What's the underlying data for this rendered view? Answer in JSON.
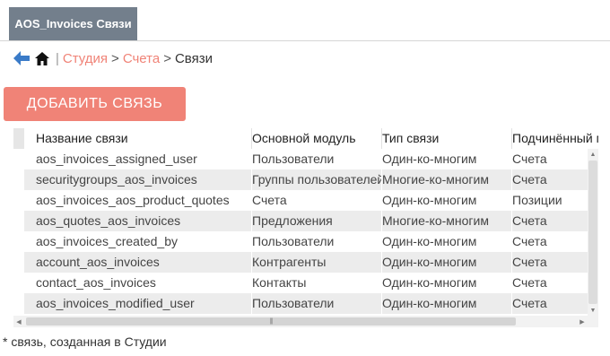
{
  "tab": {
    "label": "AOS_Invoices Связи"
  },
  "breadcrumb": {
    "back_icon": "back-arrow-icon",
    "home_icon": "home-icon",
    "separator": "|",
    "items": [
      "Студия",
      "Счета",
      "Связи"
    ],
    "arrow": ">"
  },
  "add_button": {
    "label": "ДОБАВИТЬ СВЯЗЬ"
  },
  "table": {
    "columns": [
      "Название связи",
      "Основной модуль",
      "Тип связи",
      "Подчинённый модуль"
    ],
    "rows": [
      [
        "aos_invoices_assigned_user",
        "Пользователи",
        "Один-ко-многим",
        "Счета"
      ],
      [
        "securitygroups_aos_invoices",
        "Группы пользователей",
        "Многие-ко-многим",
        "Счета"
      ],
      [
        "aos_invoices_aos_product_quotes",
        "Счета",
        "Один-ко-многим",
        "Позиции"
      ],
      [
        "aos_quotes_aos_invoices",
        "Предложения",
        "Многие-ко-многим",
        "Счета"
      ],
      [
        "aos_invoices_created_by",
        "Пользователи",
        "Один-ко-многим",
        "Счета"
      ],
      [
        "account_aos_invoices",
        "Контрагенты",
        "Один-ко-многим",
        "Счета"
      ],
      [
        "contact_aos_invoices",
        "Контакты",
        "Один-ко-многим",
        "Счета"
      ],
      [
        "aos_invoices_modified_user",
        "Пользователи",
        "Один-ко-многим",
        "Счета"
      ]
    ]
  },
  "footnote": "* связь, созданная в Студии",
  "colors": {
    "accent": "#f08377",
    "tab_bg": "#737f8c",
    "row_alt": "#ececec"
  }
}
